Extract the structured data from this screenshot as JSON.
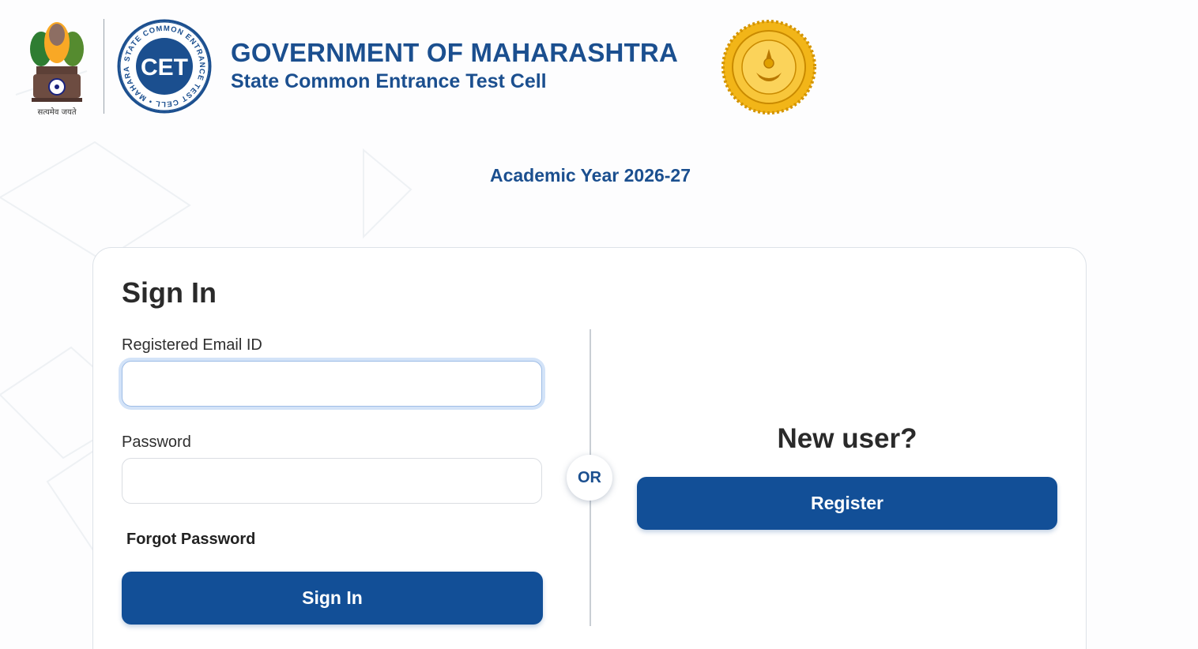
{
  "header": {
    "title": "GOVERNMENT OF MAHARASHTRA",
    "subtitle": "State Common Entrance Test Cell",
    "emblem_motto": "सत्यमेव जयते",
    "cet_logo_ring_text": "STATE COMMON ENTRANCE TEST CELL • MAHARASHTRA •",
    "cet_logo_center": "CET"
  },
  "academic_year": "Academic Year 2026-27",
  "signin": {
    "heading": "Sign In",
    "email_label": "Registered Email ID",
    "email_value": "",
    "password_label": "Password",
    "password_value": "",
    "forgot_password": "Forgot Password",
    "submit_label": "Sign In"
  },
  "divider": {
    "or_label": "OR"
  },
  "register": {
    "prompt": "New user?",
    "button_label": "Register"
  },
  "colors": {
    "brand_blue": "#1b4f8f",
    "button_blue": "#124f97",
    "seal_gold": "#f2b518"
  }
}
